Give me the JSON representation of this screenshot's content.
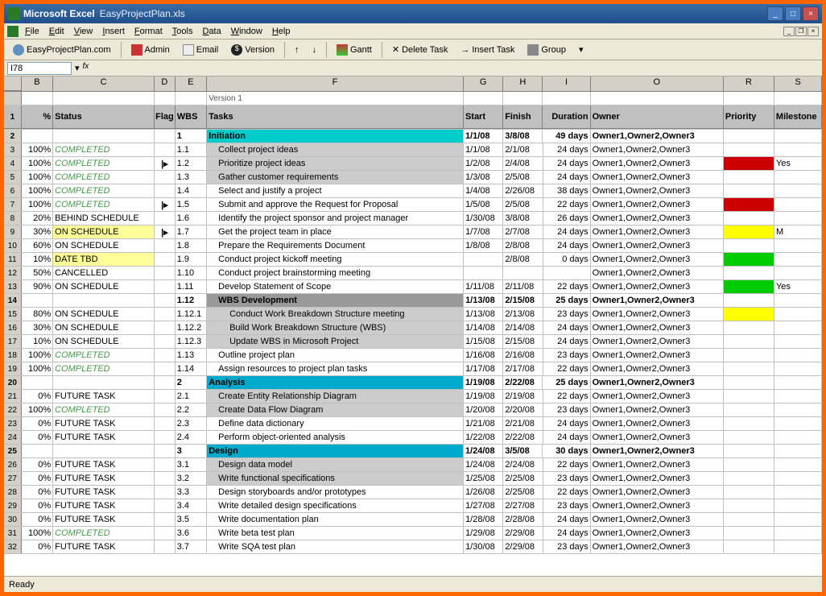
{
  "title": {
    "app": "Microsoft Excel",
    "file": "EasyProjectPlan.xls"
  },
  "menu": [
    "File",
    "Edit",
    "View",
    "Insert",
    "Format",
    "Tools",
    "Data",
    "Window",
    "Help"
  ],
  "toolbar": {
    "site": "EasyProjectPlan.com",
    "admin": "Admin",
    "email": "Email",
    "version": "Version",
    "gantt": "Gantt",
    "delete": "Delete Task",
    "insert": "Insert Task",
    "group": "Group"
  },
  "namebox": "I78",
  "versionLabel": "Version 1",
  "columns": {
    "pct": "%",
    "status": "Status",
    "flag": "Flag",
    "wbs": "WBS",
    "tasks": "Tasks",
    "start": "Start",
    "finish": "Finish",
    "duration": "Duration",
    "owner": "Owner",
    "priority": "Priority",
    "milestone": "Milestone"
  },
  "colLetters": [
    "B",
    "C",
    "D",
    "E",
    "F",
    "G",
    "H",
    "I",
    "O",
    "R",
    "S"
  ],
  "rows": [
    {
      "n": "2",
      "wbs": "1",
      "task": "Initiation",
      "taskCls": "task-init",
      "start": "1/1/08",
      "finish": "3/8/08",
      "dur": "49 days",
      "owner": "Owner1,Owner2,Owner3",
      "bold": true
    },
    {
      "n": "3",
      "pct": "100%",
      "status": "COMPLETED",
      "statusCls": "status-complete",
      "wbs": "1.1",
      "task": "Collect project ideas",
      "taskCls": "task-sub indent1",
      "start": "1/1/08",
      "finish": "2/1/08",
      "dur": "24 days",
      "owner": "Owner1,Owner2,Owner3"
    },
    {
      "n": "4",
      "pct": "100%",
      "status": "COMPLETED",
      "statusCls": "status-complete",
      "flag": "|▸",
      "wbs": "1.2",
      "task": "Prioritize project ideas",
      "taskCls": "task-sub indent1",
      "start": "1/2/08",
      "finish": "2/4/08",
      "dur": "24 days",
      "owner": "Owner1,Owner2,Owner3",
      "prio": "prio-red",
      "mile": "Yes"
    },
    {
      "n": "5",
      "pct": "100%",
      "status": "COMPLETED",
      "statusCls": "status-complete",
      "wbs": "1.3",
      "task": "Gather customer requirements",
      "taskCls": "task-sub indent1",
      "start": "1/3/08",
      "finish": "2/5/08",
      "dur": "24 days",
      "owner": "Owner1,Owner2,Owner3"
    },
    {
      "n": "6",
      "pct": "100%",
      "status": "COMPLETED",
      "statusCls": "status-complete",
      "wbs": "1.4",
      "task": "Select and justify a project",
      "taskCls": "indent1",
      "start": "1/4/08",
      "finish": "2/26/08",
      "dur": "38 days",
      "owner": "Owner1,Owner2,Owner3"
    },
    {
      "n": "7",
      "pct": "100%",
      "status": "COMPLETED",
      "statusCls": "status-complete",
      "flag": "|▸",
      "wbs": "1.5",
      "task": "Submit and approve the Request for Proposal",
      "taskCls": "indent1",
      "start": "1/5/08",
      "finish": "2/5/08",
      "dur": "22 days",
      "owner": "Owner1,Owner2,Owner3",
      "prio": "prio-red"
    },
    {
      "n": "8",
      "pct": "20%",
      "status": "BEHIND SCHEDULE",
      "wbs": "1.6",
      "task": "Identify the project sponsor and project manager",
      "taskCls": "indent1",
      "start": "1/30/08",
      "finish": "3/8/08",
      "dur": "26 days",
      "owner": "Owner1,Owner2,Owner3"
    },
    {
      "n": "9",
      "pct": "30%",
      "status": "ON SCHEDULE",
      "statusCls": "status-yellow",
      "flag": "|▸",
      "wbs": "1.7",
      "task": "Get the project team in place",
      "taskCls": "indent1",
      "start": "1/7/08",
      "finish": "2/7/08",
      "dur": "24 days",
      "owner": "Owner1,Owner2,Owner3",
      "prio": "prio-yellow",
      "mile": "M"
    },
    {
      "n": "10",
      "pct": "60%",
      "status": "ON SCHEDULE",
      "wbs": "1.8",
      "task": "Prepare the Requirements Document",
      "taskCls": "indent1",
      "start": "1/8/08",
      "finish": "2/8/08",
      "dur": "24 days",
      "owner": "Owner1,Owner2,Owner3"
    },
    {
      "n": "11",
      "pct": "10%",
      "status": "DATE TBD",
      "statusCls": "status-yellow",
      "wbs": "1.9",
      "task": "Conduct project kickoff meeting",
      "taskCls": "indent1",
      "start": "",
      "finish": "2/8/08",
      "dur": "0 days",
      "owner": "Owner1,Owner2,Owner3",
      "prio": "prio-green"
    },
    {
      "n": "12",
      "pct": "50%",
      "status": "CANCELLED",
      "wbs": "1.10",
      "task": "Conduct project brainstorming meeting",
      "taskCls": "indent1",
      "start": "",
      "finish": "",
      "dur": "",
      "owner": "Owner1,Owner2,Owner3"
    },
    {
      "n": "13",
      "pct": "90%",
      "status": "ON SCHEDULE",
      "wbs": "1.11",
      "task": "Develop Statement of Scope",
      "taskCls": "indent1",
      "start": "1/11/08",
      "finish": "2/11/08",
      "dur": "22 days",
      "owner": "Owner1,Owner2,Owner3",
      "prio": "prio-green",
      "mile": "Yes"
    },
    {
      "n": "14",
      "wbs": "1.12",
      "task": "WBS Development",
      "taskCls": "task-gray indent1",
      "start": "1/13/08",
      "finish": "2/15/08",
      "dur": "25 days",
      "owner": "Owner1,Owner2,Owner3",
      "bold": true
    },
    {
      "n": "15",
      "pct": "80%",
      "status": "ON SCHEDULE",
      "wbs": "1.12.1",
      "task": "Conduct Work Breakdown Structure meeting",
      "taskCls": "task-sub indent2",
      "start": "1/13/08",
      "finish": "2/13/08",
      "dur": "23 days",
      "owner": "Owner1,Owner2,Owner3",
      "prio": "prio-yellow"
    },
    {
      "n": "16",
      "pct": "30%",
      "status": "ON SCHEDULE",
      "wbs": "1.12.2",
      "task": "Build Work Breakdown Structure (WBS)",
      "taskCls": "task-sub indent2",
      "start": "1/14/08",
      "finish": "2/14/08",
      "dur": "24 days",
      "owner": "Owner1,Owner2,Owner3"
    },
    {
      "n": "17",
      "pct": "10%",
      "status": "ON SCHEDULE",
      "wbs": "1.12.3",
      "task": "Update WBS in Microsoft Project",
      "taskCls": "task-sub indent2",
      "start": "1/15/08",
      "finish": "2/15/08",
      "dur": "24 days",
      "owner": "Owner1,Owner2,Owner3"
    },
    {
      "n": "18",
      "pct": "100%",
      "status": "COMPLETED",
      "statusCls": "status-complete",
      "wbs": "1.13",
      "task": "Outline project plan",
      "taskCls": "indent1",
      "start": "1/16/08",
      "finish": "2/16/08",
      "dur": "23 days",
      "owner": "Owner1,Owner2,Owner3"
    },
    {
      "n": "19",
      "pct": "100%",
      "status": "COMPLETED",
      "statusCls": "status-complete",
      "wbs": "1.14",
      "task": "Assign resources to project plan tasks",
      "taskCls": "indent1",
      "start": "1/17/08",
      "finish": "2/17/08",
      "dur": "22 days",
      "owner": "Owner1,Owner2,Owner3"
    },
    {
      "n": "20",
      "wbs": "2",
      "task": "Analysis",
      "taskCls": "task-section",
      "start": "1/19/08",
      "finish": "2/22/08",
      "dur": "25 days",
      "owner": "Owner1,Owner2,Owner3",
      "bold": true
    },
    {
      "n": "21",
      "pct": "0%",
      "status": "FUTURE TASK",
      "wbs": "2.1",
      "task": "Create Entity Relationship Diagram",
      "taskCls": "task-sub indent1",
      "start": "1/19/08",
      "finish": "2/19/08",
      "dur": "22 days",
      "owner": "Owner1,Owner2,Owner3"
    },
    {
      "n": "22",
      "pct": "100%",
      "status": "COMPLETED",
      "statusCls": "status-complete",
      "wbs": "2.2",
      "task": "Create Data Flow Diagram",
      "taskCls": "task-sub indent1",
      "start": "1/20/08",
      "finish": "2/20/08",
      "dur": "23 days",
      "owner": "Owner1,Owner2,Owner3"
    },
    {
      "n": "23",
      "pct": "0%",
      "status": "FUTURE TASK",
      "wbs": "2.3",
      "task": "Define data dictionary",
      "taskCls": "indent1",
      "start": "1/21/08",
      "finish": "2/21/08",
      "dur": "24 days",
      "owner": "Owner1,Owner2,Owner3"
    },
    {
      "n": "24",
      "pct": "0%",
      "status": "FUTURE TASK",
      "wbs": "2.4",
      "task": "Perform object-oriented analysis",
      "taskCls": "indent1",
      "start": "1/22/08",
      "finish": "2/22/08",
      "dur": "24 days",
      "owner": "Owner1,Owner2,Owner3"
    },
    {
      "n": "25",
      "wbs": "3",
      "task": "Design",
      "taskCls": "task-section",
      "start": "1/24/08",
      "finish": "3/5/08",
      "dur": "30 days",
      "owner": "Owner1,Owner2,Owner3",
      "bold": true
    },
    {
      "n": "26",
      "pct": "0%",
      "status": "FUTURE TASK",
      "wbs": "3.1",
      "task": "Design data model",
      "taskCls": "task-sub indent1",
      "start": "1/24/08",
      "finish": "2/24/08",
      "dur": "22 days",
      "owner": "Owner1,Owner2,Owner3"
    },
    {
      "n": "27",
      "pct": "0%",
      "status": "FUTURE TASK",
      "wbs": "3.2",
      "task": "Write functional specifications",
      "taskCls": "task-sub indent1",
      "start": "1/25/08",
      "finish": "2/25/08",
      "dur": "23 days",
      "owner": "Owner1,Owner2,Owner3"
    },
    {
      "n": "28",
      "pct": "0%",
      "status": "FUTURE TASK",
      "wbs": "3.3",
      "task": "Design storyboards and/or prototypes",
      "taskCls": "indent1",
      "start": "1/26/08",
      "finish": "2/25/08",
      "dur": "22 days",
      "owner": "Owner1,Owner2,Owner3"
    },
    {
      "n": "29",
      "pct": "0%",
      "status": "FUTURE TASK",
      "wbs": "3.4",
      "task": "Write detailed design specifications",
      "taskCls": "indent1",
      "start": "1/27/08",
      "finish": "2/27/08",
      "dur": "23 days",
      "owner": "Owner1,Owner2,Owner3"
    },
    {
      "n": "30",
      "pct": "0%",
      "status": "FUTURE TASK",
      "wbs": "3.5",
      "task": "Write documentation plan",
      "taskCls": "indent1",
      "start": "1/28/08",
      "finish": "2/28/08",
      "dur": "24 days",
      "owner": "Owner1,Owner2,Owner3"
    },
    {
      "n": "31",
      "pct": "100%",
      "status": "COMPLETED",
      "statusCls": "status-complete",
      "wbs": "3.6",
      "task": "Write beta test plan",
      "taskCls": "indent1",
      "start": "1/29/08",
      "finish": "2/29/08",
      "dur": "24 days",
      "owner": "Owner1,Owner2,Owner3"
    },
    {
      "n": "32",
      "pct": "0%",
      "status": "FUTURE TASK",
      "wbs": "3.7",
      "task": "Write SQA test plan",
      "taskCls": "indent1",
      "start": "1/30/08",
      "finish": "2/29/08",
      "dur": "23 days",
      "owner": "Owner1,Owner2,Owner3"
    }
  ],
  "status": "Ready"
}
